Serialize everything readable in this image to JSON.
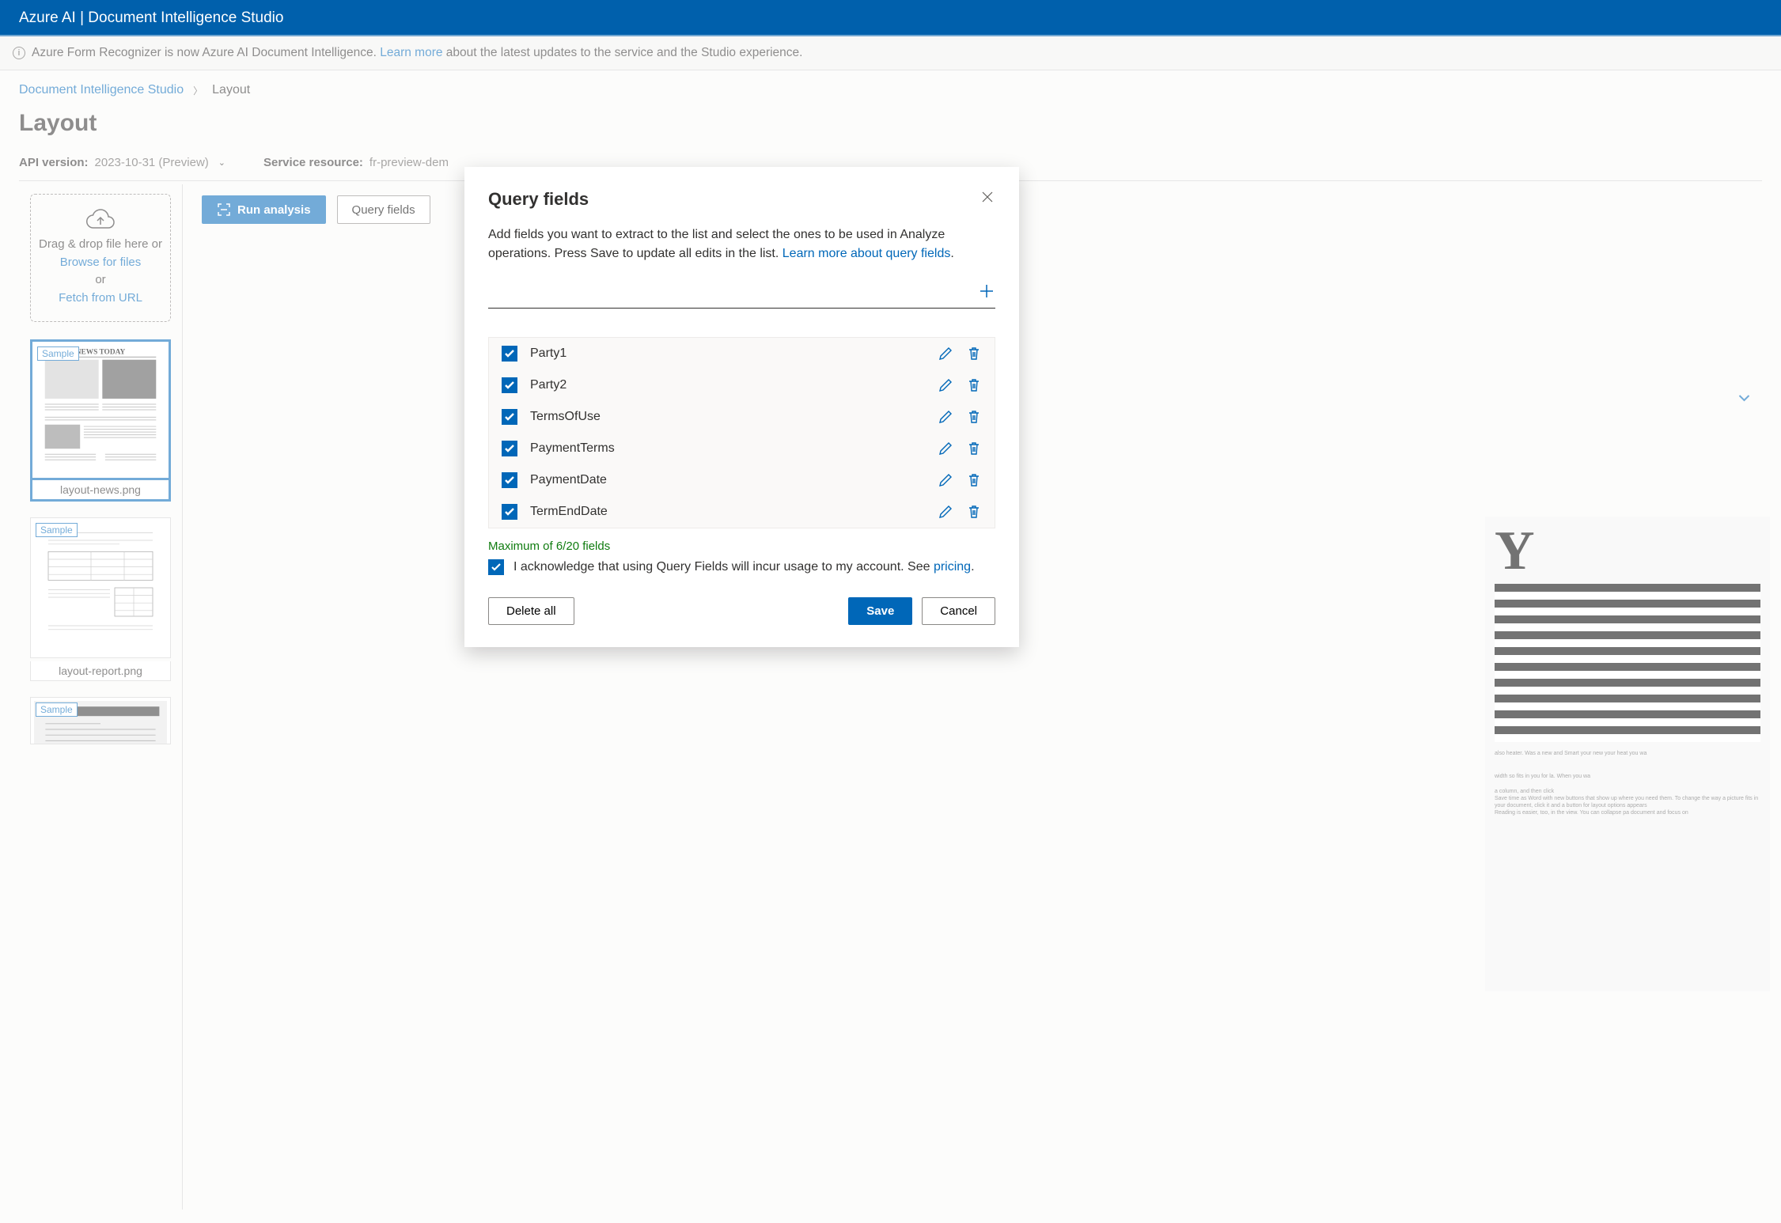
{
  "header": {
    "title": "Azure AI | Document Intelligence Studio"
  },
  "banner": {
    "text_before": "Azure Form Recognizer is now Azure AI Document Intelligence. ",
    "link": "Learn more",
    "text_after": " about the latest updates to the service and the Studio experience."
  },
  "breadcrumb": {
    "root": "Document Intelligence Studio",
    "current": "Layout"
  },
  "page": {
    "title": "Layout"
  },
  "config": {
    "api_version_label": "API version:",
    "api_version_value": "2023-10-31 (Preview)",
    "service_resource_label": "Service resource:",
    "service_resource_value": "fr-preview-dem"
  },
  "dropzone": {
    "line1": "Drag & drop file here or",
    "browse": "Browse for files",
    "or": "or",
    "fetch": "Fetch from URL"
  },
  "thumbnails": [
    {
      "badge": "Sample",
      "caption": "layout-news.png",
      "selected": true,
      "headline": "NEWS TODAY"
    },
    {
      "badge": "Sample",
      "caption": "layout-report.png",
      "selected": false
    },
    {
      "badge": "Sample",
      "caption": "",
      "selected": false
    }
  ],
  "toolbar": {
    "run_analysis": "Run analysis",
    "query_fields": "Query fields"
  },
  "modal": {
    "title": "Query fields",
    "desc_before": "Add fields you want to extract to the list and select the ones to be used in Analyze operations. Press Save to update all edits in the list. ",
    "desc_link": "Learn more about query fields",
    "fields": [
      {
        "name": "Party1",
        "checked": true
      },
      {
        "name": "Party2",
        "checked": true
      },
      {
        "name": "TermsOfUse",
        "checked": true
      },
      {
        "name": "PaymentTerms",
        "checked": true
      },
      {
        "name": "PaymentDate",
        "checked": true
      },
      {
        "name": "TermEndDate",
        "checked": true
      }
    ],
    "max_fields": "Maximum of 6/20 fields",
    "ack_before": "I acknowledge that using Query Fields will incur usage to my account. See ",
    "ack_link": "pricing",
    "ack_after": ".",
    "ack_checked": true,
    "delete_all": "Delete all",
    "save": "Save",
    "cancel": "Cancel"
  }
}
